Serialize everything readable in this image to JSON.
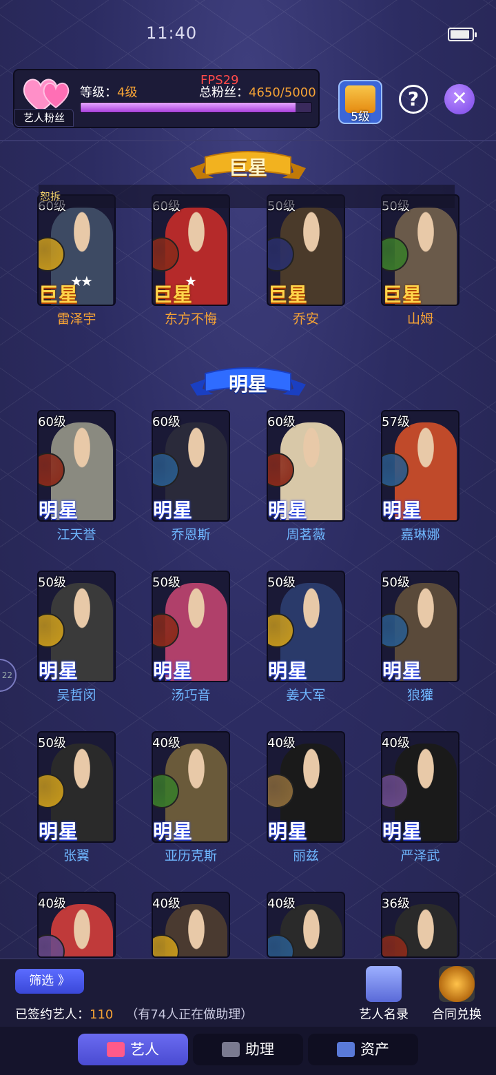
{
  "status": {
    "time": "11:40"
  },
  "fan_panel": {
    "tag": "艺人粉丝",
    "level_label": "等级：",
    "level_value": "4级",
    "fans_label": "总粉丝：",
    "fans_value": "4650/5000",
    "fans_progress": 0.93,
    "fps": "FPS29"
  },
  "top_buttons": {
    "clapper_level": "5级",
    "help": "?",
    "close": "✕"
  },
  "notice": "恕拆",
  "sections": [
    {
      "title": "巨星",
      "style": "gold",
      "cards": [
        {
          "level": "60级",
          "rank": "巨星",
          "name": "雷泽宇",
          "stars": "★★",
          "badge_color": "#c89a1c",
          "portrait_color": "#3d4a63"
        },
        {
          "level": "60级",
          "rank": "巨星",
          "name": "东方不悔",
          "stars": "★",
          "badge_color": "#8a2a1a",
          "portrait_color": "#b52a2a"
        },
        {
          "level": "50级",
          "rank": "巨星",
          "name": "乔安",
          "stars": "",
          "badge_color": "#2a2f6a",
          "portrait_color": "#4a3a2a"
        },
        {
          "level": "50级",
          "rank": "巨星",
          "name": "山姆",
          "stars": "",
          "badge_color": "#3a7a2a",
          "portrait_color": "#6a5a4a"
        }
      ]
    },
    {
      "title": "明星",
      "style": "blue",
      "cards": [
        {
          "level": "60级",
          "rank": "明星",
          "name": "江天誉",
          "badge_color": "#8a2a1a",
          "portrait_color": "#8a8a80"
        },
        {
          "level": "60级",
          "rank": "明星",
          "name": "乔恩斯",
          "badge_color": "#2a5a8a",
          "portrait_color": "#2a2a3a"
        },
        {
          "level": "60级",
          "rank": "明星",
          "name": "周茗薇",
          "badge_color": "#8a2a1a",
          "portrait_color": "#d8c8a8"
        },
        {
          "level": "57级",
          "rank": "明星",
          "name": "嘉琳娜",
          "badge_color": "#2a5a8a",
          "portrait_color": "#c04a2a"
        },
        {
          "level": "50级",
          "rank": "明星",
          "name": "吴哲闵",
          "badge_color": "#c89a1c",
          "portrait_color": "#3a3a3a"
        },
        {
          "level": "50级",
          "rank": "明星",
          "name": "汤巧音",
          "badge_color": "#8a2a1a",
          "portrait_color": "#b0406a"
        },
        {
          "level": "50级",
          "rank": "明星",
          "name": "姜大军",
          "badge_color": "#c89a1c",
          "portrait_color": "#2a3a6a"
        },
        {
          "level": "50级",
          "rank": "明星",
          "name": "狼獾",
          "badge_color": "#2a5a8a",
          "portrait_color": "#5a4a3a"
        },
        {
          "level": "50级",
          "rank": "明星",
          "name": "张翼",
          "badge_color": "#c89a1c",
          "portrait_color": "#2a2a2a"
        },
        {
          "level": "40级",
          "rank": "明星",
          "name": "亚历克斯",
          "badge_color": "#3a7a2a",
          "portrait_color": "#6a5a3a"
        },
        {
          "level": "40级",
          "rank": "明星",
          "name": "丽兹",
          "badge_color": "#8a6a3a",
          "portrait_color": "#1a1a1a"
        },
        {
          "level": "40级",
          "rank": "明星",
          "name": "严泽武",
          "badge_color": "#6a4a8a",
          "portrait_color": "#1a1a1a"
        },
        {
          "level": "40级",
          "rank": "",
          "name": "",
          "badge_color": "#6a4a8a",
          "portrait_color": "#c03a3a"
        },
        {
          "level": "40级",
          "rank": "",
          "name": "",
          "badge_color": "#c89a1c",
          "portrait_color": "#4a3a30"
        },
        {
          "level": "40级",
          "rank": "",
          "name": "",
          "badge_color": "#2a5a8a",
          "portrait_color": "#2a2a2a"
        },
        {
          "level": "36级",
          "rank": "",
          "name": "",
          "badge_color": "#8a2a1a",
          "portrait_color": "#2a2a2a"
        }
      ]
    }
  ],
  "side_tab": "22",
  "bottom": {
    "filter_label": "筛选 》",
    "signed_label": "已签约艺人：",
    "signed_count": "110",
    "signed_note": "（有74人正在做助理）",
    "roster_label": "艺人名录",
    "contract_label": "合同兑换"
  },
  "tabs": [
    {
      "label": "艺人",
      "icon": "heart-icon",
      "active": true
    },
    {
      "label": "助理",
      "icon": "assistant-icon",
      "active": false
    },
    {
      "label": "资产",
      "icon": "asset-icon",
      "active": false
    }
  ],
  "colors": {
    "gold": "#f6a335",
    "blue_name": "#6fb7ff",
    "accent": "#5b6cff"
  }
}
